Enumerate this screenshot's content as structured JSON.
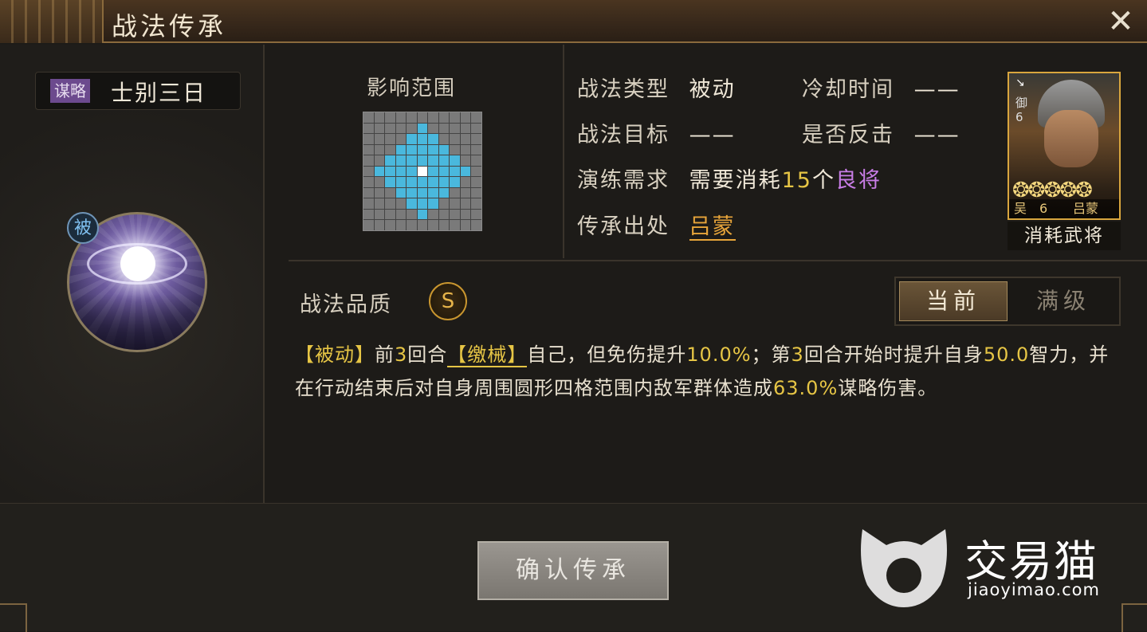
{
  "window": {
    "title": "战法传承",
    "close_glyph": "✕"
  },
  "skill": {
    "category_tag": "谋略",
    "name": "士别三日",
    "type_badge": "被",
    "icon": "eye-skill-icon"
  },
  "range": {
    "title": "影响范围",
    "grid_size": 11,
    "radius": 4,
    "hit_color": "#4ab8dd",
    "miss_color": "#7a7a7a",
    "center_color": "#ffffff"
  },
  "info": {
    "type_label": "战法类型",
    "type_value": "被动",
    "cooldown_label": "冷却时间",
    "cooldown_value": "——",
    "target_label": "战法目标",
    "target_value": "——",
    "counter_label": "是否反击",
    "counter_value": "——",
    "drill_label": "演练需求",
    "drill_prefix": "需要消耗",
    "drill_count": "15",
    "drill_unit": "个",
    "drill_item": "良将",
    "source_label": "传承出处",
    "source_value": "吕蒙"
  },
  "hero_card": {
    "mark": "↘",
    "side_text": "御6",
    "stars": "❂❂❂❂❂",
    "faction": "吴",
    "cost": "6",
    "name": "吕蒙",
    "caption": "消耗武将"
  },
  "quality": {
    "label": "战法品质",
    "grade": "S"
  },
  "level_toggle": {
    "current": "当前",
    "max": "满级"
  },
  "description": {
    "p1": "【被动】",
    "p2": "前",
    "p3": "3",
    "p4": "回合",
    "p5": "【缴械】",
    "p6": "自己，但免伤提升",
    "p7": "10.0%",
    "p8": "；第",
    "p9": "3",
    "p10": "回合开始时提升自身",
    "p11": "50.0",
    "p12": "智力，并在行动结束后对自身周围圆形四格范围内敌军群体造成",
    "p13": "63.0%",
    "p14": "谋略伤害。"
  },
  "confirm_button": "确认传承",
  "watermark": {
    "text": "交易猫",
    "url": "jiaoyimao.com"
  }
}
